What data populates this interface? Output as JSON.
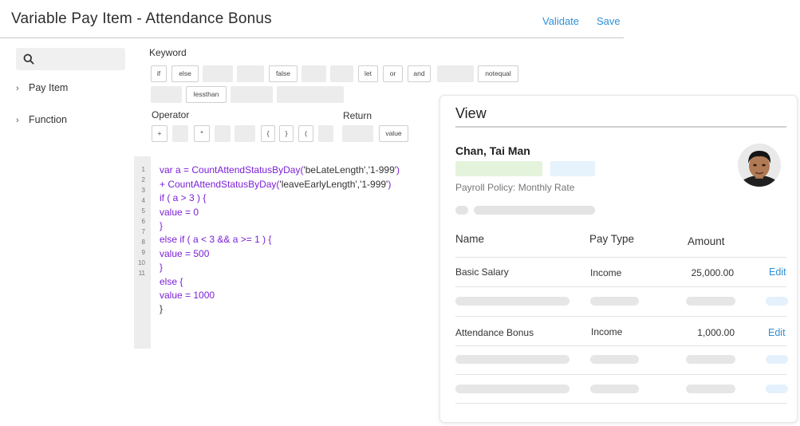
{
  "window": {
    "title": "Variable Pay Item - Attendance Bonus",
    "validate_label": "Validate",
    "save_label": "Save"
  },
  "sidebar": {
    "search_icon": "search-icon",
    "items": [
      {
        "label": "Pay Item"
      },
      {
        "label": "Function"
      }
    ]
  },
  "keywords": {
    "label": "Keyword",
    "row1": [
      "if",
      "else",
      "",
      "",
      "false",
      "",
      "",
      "let",
      "or",
      "and",
      "",
      "notequal"
    ],
    "row2": [
      "",
      "lessthan",
      "",
      ""
    ]
  },
  "operators": {
    "label": "Operator",
    "items": [
      "+",
      "",
      "*",
      "",
      "",
      "{",
      "}",
      "(",
      ""
    ]
  },
  "returns": {
    "label": "Return",
    "items": [
      "",
      "value"
    ]
  },
  "editor": {
    "line_numbers": [
      "1",
      "2",
      "3",
      "4",
      "5",
      "6",
      "7",
      "8",
      "9",
      "10",
      "11"
    ],
    "lines": [
      {
        "a": "var a = ",
        "b": "CountAttendStatusByDay(",
        "c": "'beLateLength','1-999'",
        "d": ")"
      },
      {
        "a": "+ ",
        "b": "CountAttendStatusByDay(",
        "c": "'leaveEarlyLength','1-999'",
        "d": ")"
      },
      {
        "a": "if ( a > 3 ) {"
      },
      {
        "a": "value = 0"
      },
      {
        "a": "}"
      },
      {
        "a": "else if ( a < 3 && a >= 1 ) {"
      },
      {
        "a": "value = 500"
      },
      {
        "a": "}"
      },
      {
        "a": "else {"
      },
      {
        "a": "value = 1000"
      },
      {
        "a": "}"
      }
    ]
  },
  "view": {
    "title": "View",
    "employee_name": "Chan, Tai Man",
    "policy": "Payroll Policy: Monthly Rate",
    "columns": {
      "name": "Name",
      "type": "Pay Type",
      "amount": "Amount"
    },
    "rows": [
      {
        "name": "Basic Salary",
        "type": "Income",
        "amount": "25,000.00",
        "action": "Edit"
      },
      {
        "name": "Attendance Bonus",
        "type": "Income",
        "amount": "1,000.00",
        "action": "Edit"
      }
    ]
  },
  "colors": {
    "accent": "#2d8fd8",
    "keyword_purple": "#7a1fd6"
  }
}
